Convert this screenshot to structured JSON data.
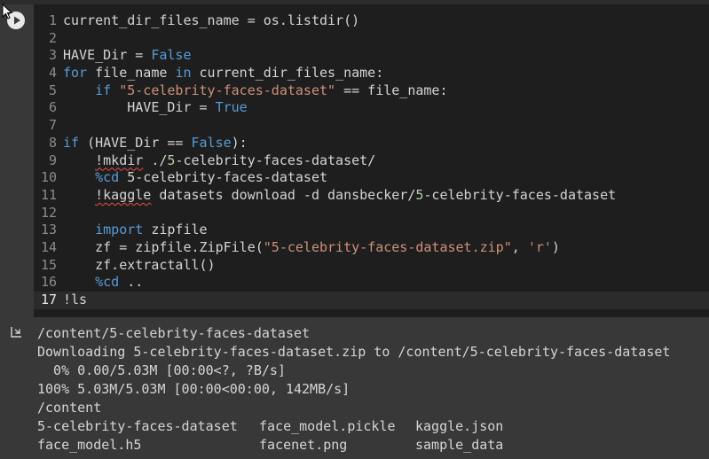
{
  "code": [
    {
      "n": "1",
      "parts": [
        {
          "t": "current_dir_files_name = os.listdir()"
        }
      ]
    },
    {
      "n": "2",
      "parts": []
    },
    {
      "n": "3",
      "parts": [
        {
          "t": "HAVE_Dir = "
        },
        {
          "t": "False",
          "c": "kw"
        }
      ]
    },
    {
      "n": "4",
      "parts": [
        {
          "t": "for",
          "c": "kw"
        },
        {
          "t": " file_name "
        },
        {
          "t": "in",
          "c": "kw"
        },
        {
          "t": " current_dir_files_name:"
        }
      ]
    },
    {
      "n": "5",
      "parts": [
        {
          "t": "    "
        },
        {
          "t": "if",
          "c": "kw"
        },
        {
          "t": " "
        },
        {
          "t": "\"5-celebrity-faces-dataset\"",
          "c": "str"
        },
        {
          "t": " == file_name:"
        }
      ]
    },
    {
      "n": "6",
      "parts": [
        {
          "t": "        HAVE_Dir = "
        },
        {
          "t": "True",
          "c": "kw"
        }
      ]
    },
    {
      "n": "7",
      "parts": []
    },
    {
      "n": "8",
      "parts": [
        {
          "t": "if",
          "c": "kw"
        },
        {
          "t": " (HAVE_Dir == "
        },
        {
          "t": "False",
          "c": "kw"
        },
        {
          "t": "):"
        }
      ]
    },
    {
      "n": "9",
      "parts": [
        {
          "t": "    "
        },
        {
          "t": "!mkdir",
          "c": "squig"
        },
        {
          "t": " ./"
        },
        {
          "t": "5",
          "c": "num"
        },
        {
          "t": "-celebrity-faces-dataset/"
        }
      ]
    },
    {
      "n": "10",
      "parts": [
        {
          "t": "    "
        },
        {
          "t": "%cd",
          "c": "mag"
        },
        {
          "t": " 5-celebrity-faces-dataset"
        }
      ]
    },
    {
      "n": "11",
      "parts": [
        {
          "t": "    "
        },
        {
          "t": "!kaggle",
          "c": "squig"
        },
        {
          "t": " datasets download -d dansbecker/"
        },
        {
          "t": "5",
          "c": "num"
        },
        {
          "t": "-celebrity-faces-dataset"
        }
      ]
    },
    {
      "n": "12",
      "parts": []
    },
    {
      "n": "13",
      "parts": [
        {
          "t": "    "
        },
        {
          "t": "import",
          "c": "kw"
        },
        {
          "t": " zipfile"
        }
      ]
    },
    {
      "n": "14",
      "parts": [
        {
          "t": "    zf = zipfile.ZipFile("
        },
        {
          "t": "\"5-celebrity-faces-dataset.zip\"",
          "c": "str"
        },
        {
          "t": ", "
        },
        {
          "t": "'r'",
          "c": "str"
        },
        {
          "t": ")"
        }
      ]
    },
    {
      "n": "15",
      "parts": [
        {
          "t": "    zf.extractall()"
        }
      ]
    },
    {
      "n": "16",
      "parts": [
        {
          "t": "    "
        },
        {
          "t": "%cd",
          "c": "mag"
        },
        {
          "t": " .."
        }
      ]
    },
    {
      "n": "17",
      "parts": [
        {
          "t": "!ls"
        }
      ],
      "active": true
    }
  ],
  "output": {
    "lines": [
      "/content/5-celebrity-faces-dataset",
      "Downloading 5-celebrity-faces-dataset.zip to /content/5-celebrity-faces-dataset",
      "  0% 0.00/5.03M [00:00<?, ?B/s]",
      "100% 5.03M/5.03M [00:00<00:00, 142MB/s]",
      "/content"
    ],
    "files": [
      [
        "5-celebrity-faces-dataset",
        "face_model.pickle",
        "kaggle.json"
      ],
      [
        "face_model.h5",
        "facenet.png",
        "sample_data"
      ]
    ]
  },
  "icons": {
    "run": "play-circle-icon",
    "output": "output-arrow-icon",
    "cursor": "mouse-pointer-icon"
  },
  "colors": {
    "keyword": "#569cd6",
    "string": "#ce9178",
    "editor_bg": "#1e1e1e",
    "output_bg": "#383838"
  }
}
